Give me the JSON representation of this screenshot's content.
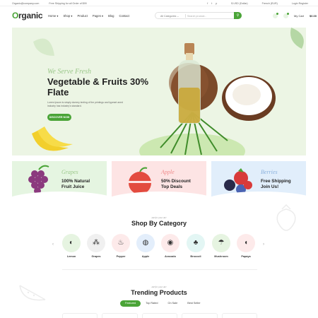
{
  "topbar": {
    "email": "Organic@company.com",
    "shipping": "Free Shipping for all Order of $99",
    "social": [
      "f",
      "t",
      "p"
    ],
    "currency": "$ USD (Dollar)",
    "language": "French (EUR)",
    "login": "Login Register"
  },
  "header": {
    "logo_o": "O",
    "logo_rest": "rganic",
    "nav": [
      "Home ▾",
      "Shop ▾",
      "Product",
      "Pages ▾",
      "Blog",
      "Contact"
    ],
    "search": {
      "category": "All Categories",
      "category_caret": "⌄",
      "placeholder": "Search product...",
      "button_icon": "⚲"
    },
    "cart_label": "My Cart",
    "cart_total": "$0.00"
  },
  "hero": {
    "eyebrow": "We Serve Fresh",
    "title": "Vegetable & Fruits 30% Flate",
    "description": "Lorem Ipsum is simply dummy texting of the printings and typeset aned industry has industry's standard.",
    "cta": "DISCOVER NOW"
  },
  "promos": [
    {
      "script": "Grapes",
      "line1": "100% Natural",
      "line2": "Fruit Juice",
      "bg": "#e5f5e1",
      "accent": "#9cc88b"
    },
    {
      "script": "Apple",
      "line1": "50% Discount",
      "line2": "Top Deals",
      "bg": "#fde4e4",
      "accent": "#ef8c8c"
    },
    {
      "script": "Berries",
      "line1": "Free Shipping",
      "line2": "Join Us!",
      "bg": "#e1eefb",
      "accent": "#8cb2dd"
    }
  ],
  "category_section": {
    "eyebrow": "All for your Art",
    "title": "Shop By Category",
    "prev": "‹",
    "next": "›",
    "items": [
      {
        "label": "Lemon",
        "icon": "lemon-icon",
        "glyph": "◐",
        "bg": "#e6f4e1"
      },
      {
        "label": "Grapes",
        "icon": "grapes-icon",
        "glyph": "⁂",
        "bg": "#f0f0f0"
      },
      {
        "label": "Pepper",
        "icon": "pepper-icon",
        "glyph": "♨",
        "bg": "#fdeaea"
      },
      {
        "label": "Apple",
        "icon": "apple-icon",
        "glyph": "◍",
        "bg": "#e3eefb"
      },
      {
        "label": "Avocado",
        "icon": "avocado-icon",
        "glyph": "◉",
        "bg": "#fdeaea"
      },
      {
        "label": "Broccoli",
        "icon": "broccoli-icon",
        "glyph": "♣",
        "bg": "#e3f6f4"
      },
      {
        "label": "Mushroom",
        "icon": "mushroom-icon",
        "glyph": "☂",
        "bg": "#e6f4e1"
      },
      {
        "label": "Papaya",
        "icon": "papaya-icon",
        "glyph": "◖",
        "bg": "#fdeaea"
      }
    ]
  },
  "trending": {
    "eyebrow": "All for your Art",
    "title": "Trending Products",
    "tabs": [
      "Featured",
      "Top Rated",
      "On Sale",
      "Best Seller"
    ]
  },
  "colors": {
    "brand_green": "#4aa437",
    "hero_bg": "#ecf5e4"
  }
}
